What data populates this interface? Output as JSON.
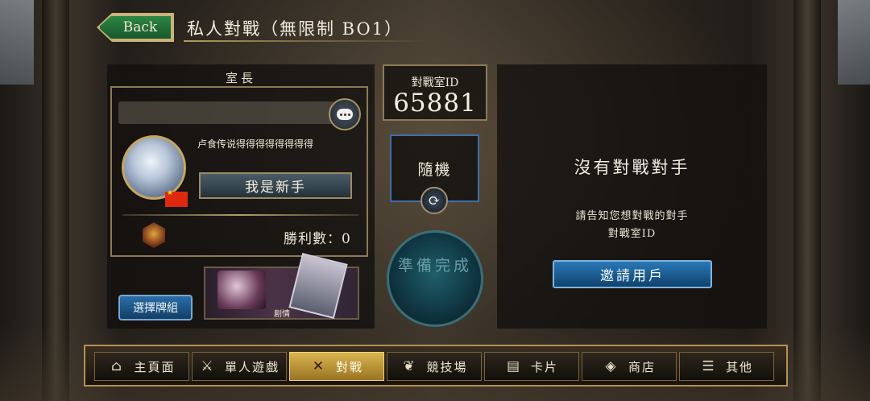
{
  "header": {
    "back_label": "Back",
    "title": "私人對戰（無限制 BO1）"
  },
  "host_panel": {
    "label": "室長",
    "player_name": "卢食传说得得得得得得得得",
    "newbie_label": "我是新手",
    "wins_text": "勝利數：0",
    "deck_button": "選擇牌組",
    "deck_name": "剧情"
  },
  "room": {
    "id_label": "對戰室ID",
    "id_value": "65881",
    "random_label": "隨機",
    "ready_label": "準備完成"
  },
  "opponent_panel": {
    "no_opponent": "沒有對戰對手",
    "hint_line1": "請告知您想對戰的對手",
    "hint_line2": "對戰室ID",
    "invite_button": "邀請用戶"
  },
  "nav": {
    "items": [
      {
        "label": "主頁面",
        "icon": "home-icon"
      },
      {
        "label": "單人遊戲",
        "icon": "sword-shield-icon"
      },
      {
        "label": "對戰",
        "icon": "crossed-swords-icon",
        "active": true
      },
      {
        "label": "競技場",
        "icon": "laurel-icon"
      },
      {
        "label": "卡片",
        "icon": "cards-icon"
      },
      {
        "label": "商店",
        "icon": "shop-icon"
      },
      {
        "label": "其他",
        "icon": "scroll-icon"
      }
    ]
  },
  "colors": {
    "accent_gold": "#b39152",
    "active_tab": "#d9b44e",
    "button_blue": "#2a78b6",
    "back_green": "#2f8a45"
  }
}
